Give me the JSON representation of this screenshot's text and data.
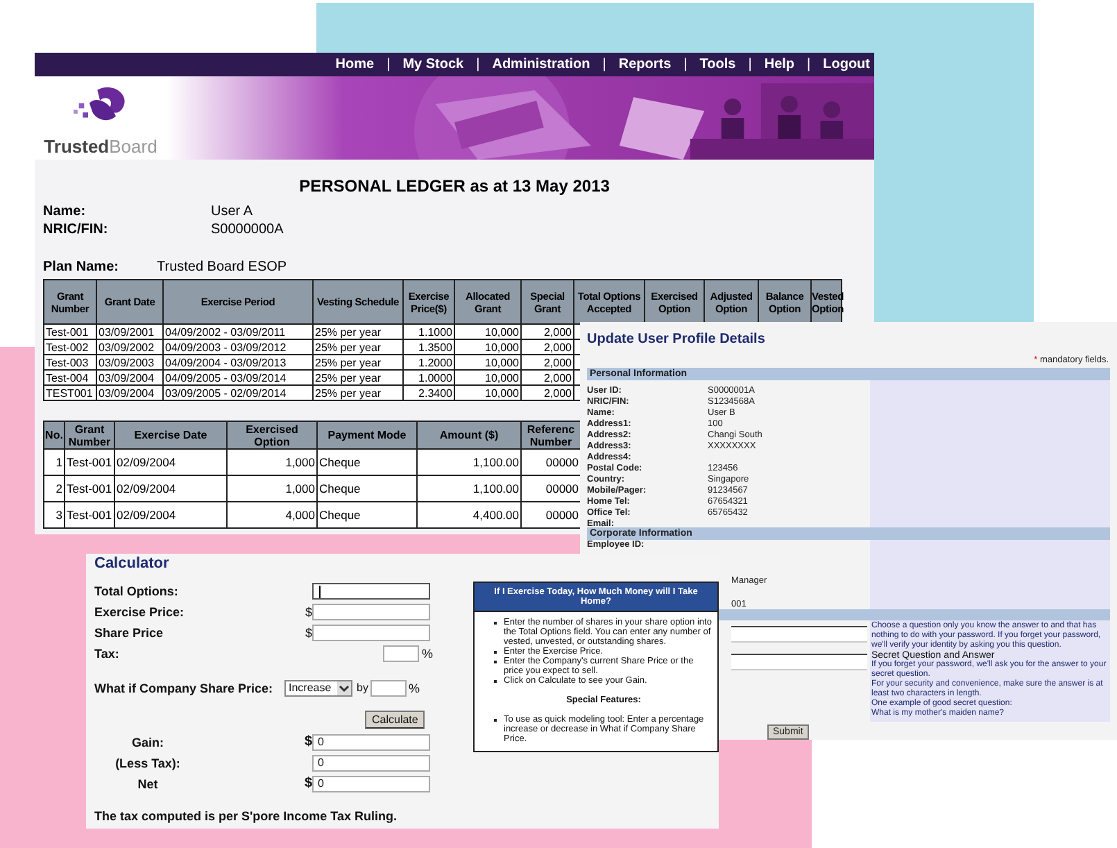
{
  "ledger": {
    "nav": [
      {
        "kind": "link",
        "label": "Home"
      },
      {
        "kind": "separator",
        "label": "|"
      },
      {
        "kind": "link",
        "label": "My Stock"
      },
      {
        "kind": "separator",
        "label": "|"
      },
      {
        "kind": "link",
        "label": "Administration"
      },
      {
        "kind": "separator",
        "label": "|"
      },
      {
        "kind": "link",
        "label": "Reports"
      },
      {
        "kind": "separator",
        "label": "|"
      },
      {
        "kind": "link",
        "label": "Tools"
      },
      {
        "kind": "separator",
        "label": "|"
      },
      {
        "kind": "link",
        "label": "Help"
      },
      {
        "kind": "separator",
        "label": "|"
      },
      {
        "kind": "link",
        "label": "Logout"
      }
    ],
    "logo_text": "**Trusted**Board",
    "title": "PERSONAL LEDGER as at 13 May 2013",
    "fields": [
      {
        "label": "Name:",
        "value": "User A"
      },
      {
        "label": "NRIC/FIN:",
        "value": "S0000000A"
      }
    ],
    "plan": {
      "label": "Plan Name:",
      "value": "Trusted Board ESOP"
    },
    "grants": {
      "columns": [
        "Grant Number",
        "Grant Date",
        "Exercise Period",
        "Vesting Schedule",
        "Exercise Price($)",
        "Allocated Grant",
        "Special Grant",
        "Total Options Accepted",
        "Exercised Option",
        "Adjusted Option",
        "Balance Option",
        "Vested Option"
      ],
      "rows": [
        [
          "Test-001",
          "03/09/2001",
          "04/09/2002 - 03/09/2011",
          "25% per year",
          "1.1000",
          "10,000",
          "2,000"
        ],
        [
          "Test-002",
          "03/09/2002",
          "04/09/2003 - 03/09/2012",
          "25% per year",
          "1.3500",
          "10,000",
          "2,000"
        ],
        [
          "Test-003",
          "03/09/2003",
          "04/09/2004 - 03/09/2013",
          "25% per year",
          "1.2000",
          "10,000",
          "2,000"
        ],
        [
          "Test-004",
          "03/09/2004",
          "04/09/2005 - 03/09/2014",
          "25% per year",
          "1.0000",
          "10,000",
          "2,000"
        ],
        [
          "TEST001",
          "03/09/2004",
          "03/09/2005 - 02/09/2014",
          "25% per year",
          "2.3400",
          "10,000",
          "2,000"
        ]
      ]
    },
    "exercises": {
      "columns": [
        "No.",
        "Grant Number",
        "Exercise Date",
        "Exercised Option",
        "Payment Mode",
        "Amount ($)",
        "Referenc Number"
      ],
      "rows": [
        [
          "1",
          "Test-001",
          "02/09/2004",
          "1,000",
          "Cheque",
          "1,100.00",
          "00000"
        ],
        [
          "2",
          "Test-001",
          "02/09/2004",
          "1,000",
          "Cheque",
          "1,100.00",
          "00000"
        ],
        [
          "3",
          "Test-001",
          "02/09/2004",
          "4,000",
          "Cheque",
          "4,400.00",
          "00000"
        ]
      ]
    }
  },
  "profile": {
    "title": "Update User Profile Details",
    "mandatory_mark": "*",
    "mandatory_text": "mandatory fields.",
    "personal": {
      "heading": "Personal Information",
      "fields": [
        {
          "label": "User ID:",
          "value": "S0000001A"
        },
        {
          "label": "NRIC/FIN:",
          "value": "S1234568A"
        },
        {
          "label": "Name:",
          "value": "User B"
        },
        {
          "label": "Address1:",
          "value": "100"
        },
        {
          "label": "Address2:",
          "value": "Changi South"
        },
        {
          "label": "Address3:",
          "value": "XXXXXXXX"
        },
        {
          "label": "Address4:"
        },
        {
          "label": "Postal Code:",
          "value": "123456"
        },
        {
          "label": "Country:",
          "value": "Singapore"
        },
        {
          "label": "Mobile/Pager:",
          "value": "91234567"
        },
        {
          "label": "Home Tel:",
          "value": "67654321"
        },
        {
          "label": "Office Tel:",
          "value": "65765432"
        },
        {
          "label": "Email:"
        }
      ]
    },
    "corporate": {
      "heading": "Corporate Information",
      "fields": [
        {
          "label": "Employee ID:"
        }
      ],
      "visible_values": [
        "Manager",
        "001"
      ]
    },
    "secret": {
      "inputs": [
        {
          "kind": "text"
        },
        {
          "kind": "text"
        }
      ],
      "help": [
        {
          "kind": "text",
          "text": "Choose a question only you know the answer to and that has nothing to do with your password. If you forget your password, we'll verify your identity by asking you this question."
        },
        {
          "kind": "heading",
          "text": "Secret Question and Answer"
        },
        {
          "kind": "text",
          "text": "If you forget your password, we'll ask you for the answer to your secret question."
        },
        {
          "kind": "text",
          "text": "For your security and convenience, make sure the answer is at least two characters in length."
        },
        {
          "kind": "text",
          "text": "One example of good secret question:"
        },
        {
          "kind": "text",
          "text": "What is my mother's maiden name?"
        }
      ]
    },
    "submit": "Submit"
  },
  "calculator": {
    "title": "Calculator",
    "fields": [
      {
        "label": "Total Options:",
        "kind": "wide",
        "focused": true
      },
      {
        "label": "Exercise Price:",
        "prefix": "$",
        "kind": "wide",
        "focused": false
      },
      {
        "label": "Share Price",
        "prefix": "$",
        "kind": "wide",
        "focused": false
      },
      {
        "label": "Tax:",
        "suffix": "%",
        "kind": "small",
        "focused": false
      }
    ],
    "what_if": {
      "label": "What if Company Share Price:",
      "select": "Increase",
      "by": "by",
      "suffix": "%"
    },
    "calculate": "Calculate",
    "results": [
      {
        "label": "Gain:",
        "prefix": "$",
        "value": "0"
      },
      {
        "label": "(Less Tax):",
        "value": "0"
      },
      {
        "label": "Net",
        "prefix": "$",
        "value": "0"
      }
    ],
    "footer": "The tax computed is per S'pore Income Tax Ruling.",
    "help": {
      "title": "If I Exercise Today, How Much Money will I Take Home?",
      "items": [
        {
          "kind": "bullet",
          "text": "Enter the number of shares in your share option into the Total Options field. You can enter any number of vested, unvested, or outstanding shares."
        },
        {
          "kind": "bullet",
          "text": "Enter the Exercise Price."
        },
        {
          "kind": "bullet",
          "text": "Enter the Company's current Share Price or the price you expect to sell."
        },
        {
          "kind": "bullet",
          "text": "Click on Calculate to see your Gain."
        },
        {
          "kind": "heading",
          "text": "Special Features:"
        },
        {
          "kind": "bullet",
          "text": "To use as quick modeling tool: Enter a percentage increase or decrease in What if Company Share Price."
        }
      ]
    }
  }
}
